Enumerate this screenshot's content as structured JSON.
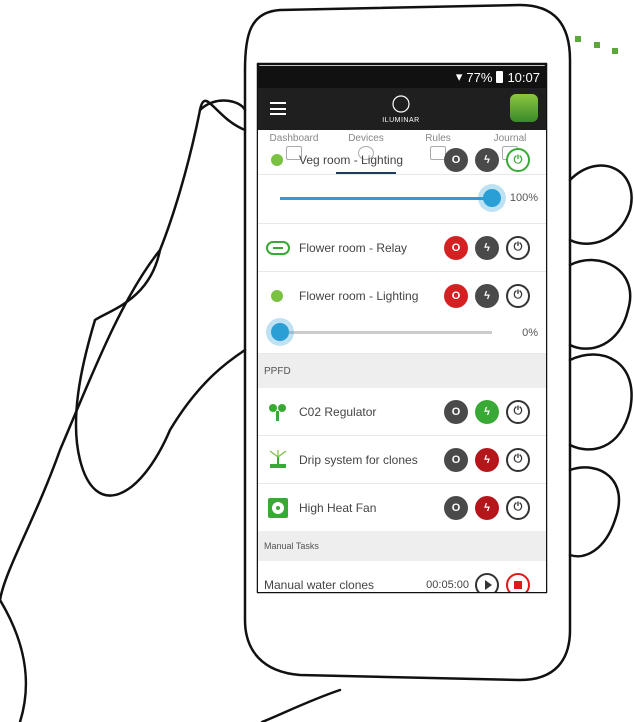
{
  "status": {
    "battery": "77%",
    "time": "10:07"
  },
  "app": {
    "logo_text": "ILUMINAR"
  },
  "tabs": [
    {
      "label": "Dashboard"
    },
    {
      "label": "Devices"
    },
    {
      "label": "Rules"
    },
    {
      "label": "Journal"
    }
  ],
  "rows": {
    "veg": {
      "label": "Veg room - Lighting",
      "slider_value": "100%",
      "level": 1.0
    },
    "flower_relay": {
      "label": "Flower room - Relay"
    },
    "flower_light": {
      "label": "Flower room - Lighting",
      "slider_value": "0%",
      "level": 0.0
    }
  },
  "sections": {
    "ppfd": "PPFD",
    "manual": "Manual Tasks"
  },
  "ppfd_devices": {
    "co2": {
      "label": "C02 Regulator"
    },
    "drip": {
      "label": "Drip system for clones"
    },
    "fan": {
      "label": "High Heat Fan"
    }
  },
  "task": {
    "label": "Manual water clones",
    "time": "00:05:00"
  },
  "colors": {
    "accent": "#2a9fd6",
    "off_red": "#d42020",
    "auto_green": "#39a935",
    "auto_red": "#b5161c"
  }
}
